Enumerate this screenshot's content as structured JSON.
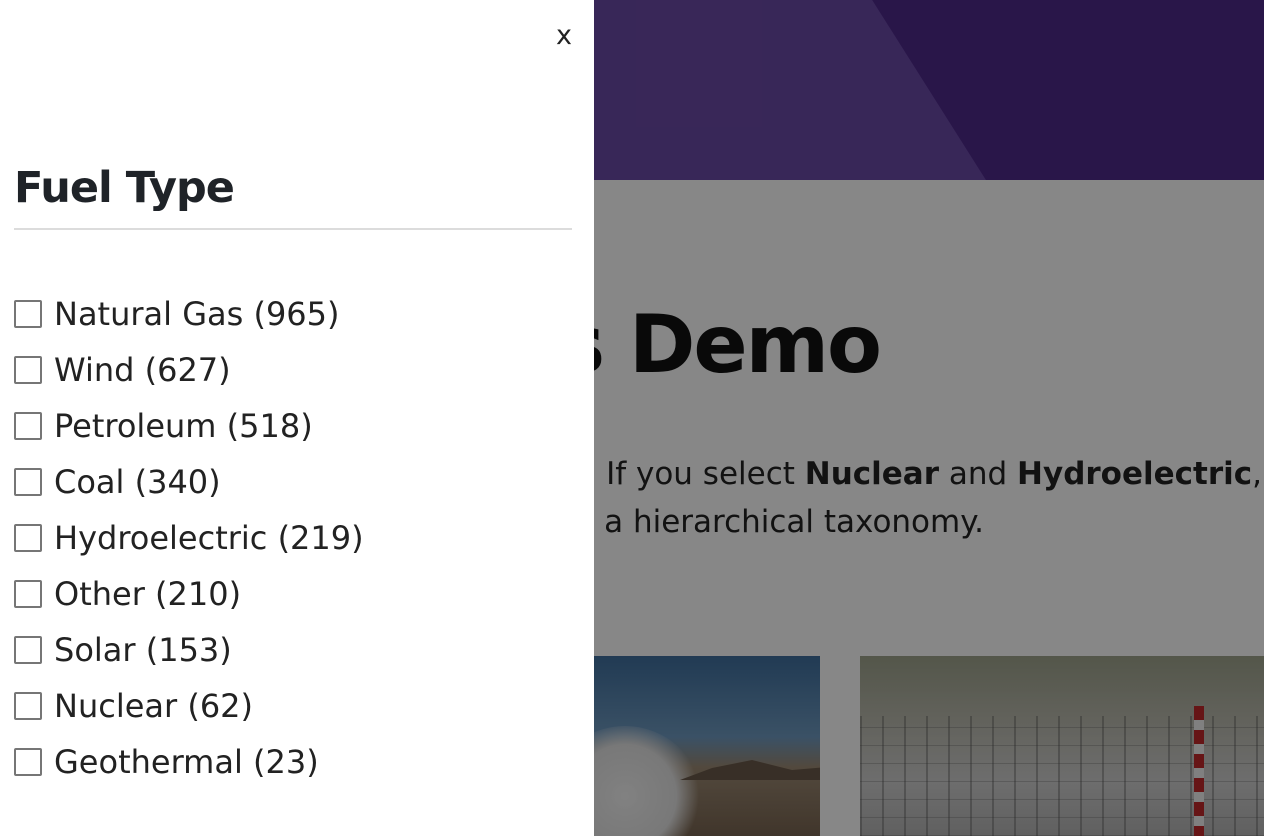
{
  "background": {
    "page_title": "s Demo",
    "intro_line_1": {
      "before": "e. If you select ",
      "bold_1": "Nuclear",
      "middle": " and ",
      "bold_2": "Hydroelectric",
      "after": ","
    },
    "intro_line_2": "a hierarchical taxonomy."
  },
  "drawer": {
    "close_label": "x",
    "title": "Fuel Type",
    "facets": [
      {
        "label": "Natural Gas (965)"
      },
      {
        "label": "Wind (627)"
      },
      {
        "label": "Petroleum (518)"
      },
      {
        "label": "Coal (340)"
      },
      {
        "label": "Hydroelectric (219)"
      },
      {
        "label": "Other (210)"
      },
      {
        "label": "Solar (153)"
      },
      {
        "label": "Nuclear (62)"
      },
      {
        "label": "Geothermal (23)"
      }
    ]
  },
  "colors": {
    "banner": "#6b4aa6",
    "banner_dark": "#4e2a8a",
    "overlay": "rgba(0,0,0,0.47)",
    "drawer_bg": "#ffffff",
    "text_dark": "#1f2328"
  }
}
